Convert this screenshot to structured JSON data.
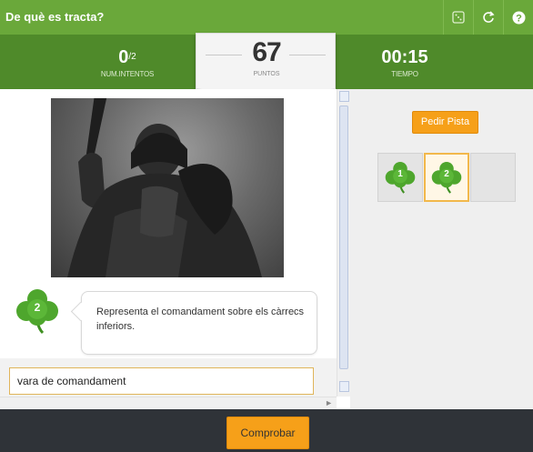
{
  "app": {
    "title": "De què es tracta?"
  },
  "toolbar": {
    "icons": [
      "dice-icon",
      "refresh-icon",
      "help-icon"
    ]
  },
  "stats": {
    "attempts": {
      "value": "0",
      "max": "/2",
      "label": "NUM.INTENTOS"
    },
    "points": {
      "value": "67",
      "label": "PUNTOS"
    },
    "time": {
      "value": "00:15",
      "label": "TIEMPO"
    }
  },
  "clue": {
    "number": "2",
    "text": "Representa el comandament sobre els càrrecs inferiors."
  },
  "answer": {
    "value": "vara de comandament"
  },
  "hints": {
    "button_label": "Pedir Pista",
    "slots": [
      {
        "number": "1",
        "state": "used"
      },
      {
        "number": "2",
        "state": "active"
      },
      {
        "number": "",
        "state": "empty"
      }
    ]
  },
  "footer": {
    "check_label": "Comprobar"
  },
  "colors": {
    "header_green": "#6aa83a",
    "score_green": "#4f8a2a",
    "accent_orange": "#f6a019",
    "footer_dark": "#2f3338"
  }
}
